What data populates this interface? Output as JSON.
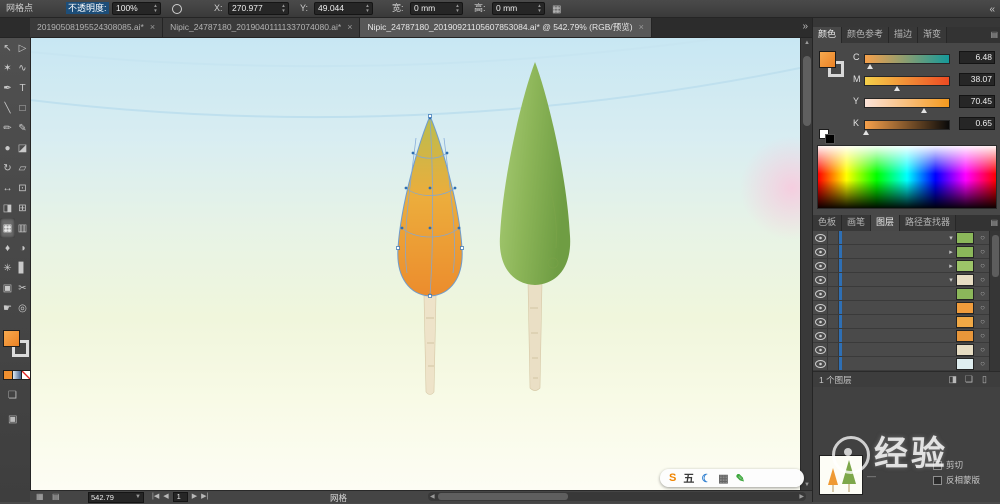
{
  "topbar": {
    "context_label": "网格点",
    "opacity_label": "不透明度:",
    "opacity_value": "100%",
    "x_label": "X:",
    "x_value": "270.977",
    "y_label": "Y:",
    "y_value": "49.044",
    "w_label": "宽:",
    "w_value": "0 mm",
    "h_label": "高:",
    "h_value": "0 mm"
  },
  "icons": {
    "dock_collapse": "«",
    "tab_overflow": "»",
    "panel_menu": "▤",
    "close": "×",
    "dropdown": "▼",
    "style_circle": "",
    "transform": "▦",
    "status_icon_1": "▦",
    "status_icon_2": "▤",
    "scroll_up": "▲",
    "scroll_down": "▼",
    "scroll_left": "◀",
    "scroll_right": "▶",
    "layers_footer_icons": [
      "◨",
      "❏",
      "▯"
    ]
  },
  "tabbar": {
    "tabs": [
      {
        "label": "20190508195524308085.ai*",
        "active": false
      },
      {
        "label": "Nipic_24787180_20190401111337074080.ai*",
        "active": false
      },
      {
        "label": "Nipic_24787180_20190921105607853084.ai* @ 542.79% (RGB/预览)",
        "active": true
      }
    ]
  },
  "toolbar": {
    "fill_color": "#ef8f2f",
    "tools": [
      {
        "name": "selection-tool",
        "glyph": "↖",
        "active": false
      },
      {
        "name": "direct-selection-tool",
        "glyph": "▷",
        "active": false
      },
      {
        "name": "magic-wand-tool",
        "glyph": "✶",
        "active": false
      },
      {
        "name": "lasso-tool",
        "glyph": "∿",
        "active": false
      },
      {
        "name": "pen-tool",
        "glyph": "✒",
        "active": false
      },
      {
        "name": "type-tool",
        "glyph": "T",
        "active": false
      },
      {
        "name": "line-tool",
        "glyph": "╲",
        "active": false
      },
      {
        "name": "rectangle-tool",
        "glyph": "□",
        "active": false
      },
      {
        "name": "paintbrush-tool",
        "glyph": "✏",
        "active": false
      },
      {
        "name": "pencil-tool",
        "glyph": "✎",
        "active": false
      },
      {
        "name": "blob-brush-tool",
        "glyph": "●",
        "active": false
      },
      {
        "name": "eraser-tool",
        "glyph": "◪",
        "active": false
      },
      {
        "name": "rotate-tool",
        "glyph": "↻",
        "active": false
      },
      {
        "name": "scale-tool",
        "glyph": "▱",
        "active": false
      },
      {
        "name": "width-tool",
        "glyph": "↔",
        "active": false
      },
      {
        "name": "free-transform-tool",
        "glyph": "⊡",
        "active": false
      },
      {
        "name": "shape-builder-tool",
        "glyph": "◨",
        "active": false
      },
      {
        "name": "perspective-grid-tool",
        "glyph": "⊞",
        "active": false
      },
      {
        "name": "mesh-tool",
        "glyph": "▦",
        "active": true
      },
      {
        "name": "gradient-tool",
        "glyph": "▥",
        "active": false
      },
      {
        "name": "eyedropper-tool",
        "glyph": "♦",
        "active": false
      },
      {
        "name": "blend-tool",
        "glyph": "◑",
        "active": false
      },
      {
        "name": "symbol-sprayer-tool",
        "glyph": "✳",
        "active": false
      },
      {
        "name": "column-graph-tool",
        "glyph": "▋",
        "active": false
      },
      {
        "name": "artboard-tool",
        "glyph": "▣",
        "active": false
      },
      {
        "name": "slice-tool",
        "glyph": "✂",
        "active": false
      },
      {
        "name": "hand-tool",
        "glyph": "☛",
        "active": false
      },
      {
        "name": "zoom-tool",
        "glyph": "◎",
        "active": false
      }
    ]
  },
  "statusbar": {
    "zoom_value": "542.79",
    "artboard_number": "1",
    "status_text": "网格",
    "nav": {
      "first": "|◀",
      "prev": "◀",
      "next": "▶",
      "last": "▶|"
    }
  },
  "dock": {
    "color_panel": {
      "tabs": [
        {
          "label": "颜色",
          "active": true
        },
        {
          "label": "颜色参考",
          "active": false
        },
        {
          "label": "描边",
          "active": false
        },
        {
          "label": "渐变",
          "active": false
        }
      ],
      "sliders": [
        {
          "label": "C",
          "value": "6.48",
          "pct": 6.48,
          "from": "#f6a04b",
          "to": "#159a9a"
        },
        {
          "label": "M",
          "value": "38.07",
          "pct": 38.07,
          "from": "#f5d04a",
          "to": "#ee4b23"
        },
        {
          "label": "Y",
          "value": "70.45",
          "pct": 70.45,
          "from": "#fbe3d9",
          "to": "#f59a1e"
        },
        {
          "label": "K",
          "value": "0.65",
          "pct": 0.65,
          "from": "#f6a04b",
          "to": "#0a0a0a"
        }
      ]
    },
    "panel_tabs": [
      {
        "label": "色板",
        "active": false
      },
      {
        "label": "画笔",
        "active": false
      },
      {
        "label": "图层",
        "active": true
      },
      {
        "label": "路径查找器",
        "active": false
      }
    ],
    "layers": {
      "count_label": "1 个图层",
      "rows": [
        {
          "expand": "down",
          "thumb": "#8bb75a"
        },
        {
          "expand": "right",
          "thumb": "#8bb75a"
        },
        {
          "expand": "right",
          "thumb": "#9cc468"
        },
        {
          "expand": "down",
          "thumb": "#e6dcc2"
        },
        {
          "expand": "",
          "thumb": "#8bb75a"
        },
        {
          "expand": "",
          "thumb": "#f09c3c"
        },
        {
          "expand": "",
          "thumb": "#f0a845"
        },
        {
          "expand": "",
          "thumb": "#e8963a"
        },
        {
          "expand": "",
          "thumb": "#e6dcc2"
        },
        {
          "expand": "",
          "thumb": "#dfeef0"
        }
      ]
    },
    "transparency": {
      "clip_label": "剪切",
      "invert_label": "反相蒙版"
    }
  },
  "watermark": {
    "text": "经验"
  },
  "ime": {
    "icons": [
      {
        "name": "sogou-logo-icon",
        "glyph": "S",
        "color": "#f08400"
      },
      {
        "name": "wubi-mode-icon",
        "glyph": "五",
        "color": "#3a3a3a"
      },
      {
        "name": "moon-icon",
        "glyph": "☾",
        "color": "#2f7fd0"
      },
      {
        "name": "keyboard-icon",
        "glyph": "▦",
        "color": "#666666"
      },
      {
        "name": "handwriting-icon",
        "glyph": "✎",
        "color": "#3aa63a"
      }
    ]
  }
}
